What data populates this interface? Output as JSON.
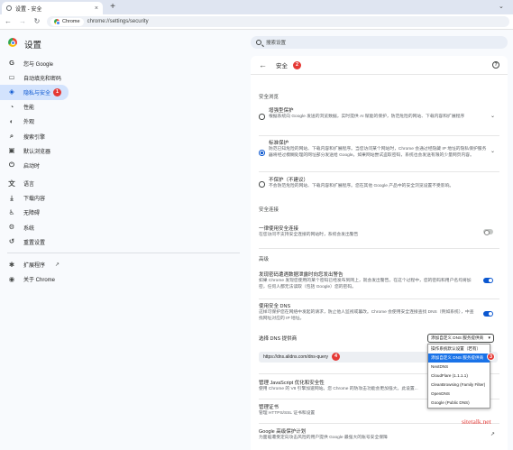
{
  "tab": {
    "title": "设置 - 安全",
    "close": "×"
  },
  "new_tab": "+",
  "toolbar": {
    "chip_label": "Chrome",
    "url": "chrome://settings/security"
  },
  "header": {
    "title": "设置",
    "search_placeholder": "搜索设置"
  },
  "sidebar": {
    "items": [
      {
        "label": "您与 Google",
        "icon": "G"
      },
      {
        "label": "自动填充和密码",
        "icon": "▭"
      },
      {
        "label": "隐私与安全",
        "icon": "◈"
      },
      {
        "label": "性能",
        "icon": "◔"
      },
      {
        "label": "外观",
        "icon": "◐"
      },
      {
        "label": "搜索引擎",
        "icon": "⌕"
      },
      {
        "label": "默认浏览器",
        "icon": "▣"
      },
      {
        "label": "启动时",
        "icon": "⏻"
      },
      {
        "label": "语言",
        "icon": "文"
      },
      {
        "label": "下载内容",
        "icon": "⤓"
      },
      {
        "label": "无障碍",
        "icon": "♿"
      },
      {
        "label": "系统",
        "icon": "⚙"
      },
      {
        "label": "重置设置",
        "icon": "↺"
      },
      {
        "label": "扩展程序",
        "icon": "✱"
      },
      {
        "label": "关于 Chrome",
        "icon": "◉"
      }
    ]
  },
  "badges": {
    "one": "1",
    "two": "2",
    "three": "3",
    "four": "4"
  },
  "card": {
    "title": "安全",
    "help": "?",
    "section_protection": "安全浏览",
    "enhanced": {
      "title": "增强型保护",
      "desc": "根据系统向 Google 发送的浏览数据，实时提供 AI 赋能的保护，防范危险的网站、下载内容和扩展程序"
    },
    "standard": {
      "title": "标准保护",
      "desc": "防范已知危险的网站、下载内容和扩展程序。当您访问某个网站时，Chrome 会通过经隐藏 IP 地址的隐私保护服务器将经过模糊处理的网址部分发送给 Google。如果网站尝试盗取密码，系统也会发送有限的少量网页内容。"
    },
    "none": {
      "title": "不保护（不建议）",
      "desc": "不会防范危险的网站、下载内容和扩展程序。您在其他 Google 产品中的安全浏览设置不受影响。"
    },
    "section_connections": "安全连接",
    "https_first": {
      "title": "一律使用安全连接",
      "desc": "在您访问不支持安全连接的网站时，系统会发出警告"
    },
    "section_advanced": "高级",
    "password_leak": {
      "title": "发现密码遭遇数据泄露时向您发出警告",
      "desc": "如果 Chrome 发现您使用的某个密码已经发布到网上，就会发出警告。在这个过程中，您的密码和用户名均将加密，任何人都无法读取（包括 Google）您的密码。"
    },
    "secure_dns": {
      "title": "使用安全 DNS",
      "desc": "这样可保护您在网络中发起的请求，防止他人监视或篡改。Chrome 会使用安全连接查找 DNS（例如系统），中查找网址对应的 IP 地址。"
    },
    "dns_provider_label": "选择 DNS 提供商",
    "dns_input_value": "https://dns.alidns.com/dns-query",
    "js_optimization": {
      "title": "管理 JavaScript 优化和安全性",
      "desc": "使用 Chrome 的 V8 引擎加速网站。您 Chrome 的防攻击功能会更加强大。此设置..."
    },
    "certificates": {
      "title": "管理证书",
      "desc": "管理 HTTPS/SSL 证书和设置"
    },
    "advanced_protection": {
      "title": "Google 高级保护计划",
      "desc": "为面临遭受定向攻击风险的用户提供 Google 最强大的账号安全保障"
    }
  },
  "dns_select": {
    "value": "添加自定义 DNS 服务提供商",
    "options": [
      "操作系统默认设置（若有）",
      "添加自定义 DNS 服务提供商",
      "NextDNS",
      "CloudFlare (1.1.1.1)",
      "CleanBrowsing (Family Filter)",
      "OpenDNS",
      "Google (Public DNS)"
    ]
  },
  "watermark": "sitetalk.net",
  "colors": {
    "accent": "#0b57d0",
    "active_nav_bg": "#d3e3fd",
    "badge": "#e53935",
    "dropdown_selected": "#1a73e8"
  }
}
